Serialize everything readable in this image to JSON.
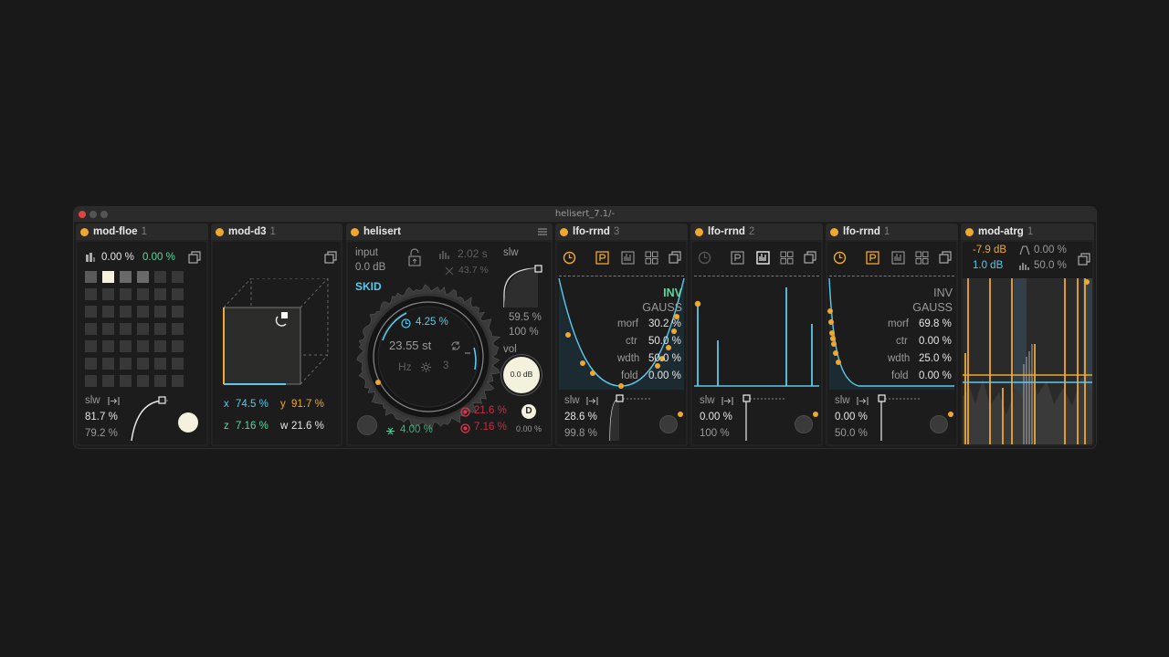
{
  "window": {
    "title": "helisert_7.1/-"
  },
  "colors": {
    "accent": "#f0a830",
    "cyan": "#5fc8ea",
    "green": "#5fd6a0",
    "red": "#e8304a"
  },
  "devices": {
    "floe": {
      "name": "mod-floe",
      "num": "1",
      "val1": "0.00 %",
      "val2": "0.00 %",
      "slw_label": "slw",
      "slw_val1": "81.7 %",
      "slw_val2": "79.2 %"
    },
    "d3": {
      "name": "mod-d3",
      "num": "1",
      "x_label": "x",
      "x_val": "74.5 %",
      "y_label": "y",
      "y_val": "91.7 %",
      "z_label": "z",
      "z_val": "7.16 %",
      "w_label": "w",
      "w_val": "21.6 %"
    },
    "heli": {
      "name": "helisert",
      "input_label": "input",
      "input_val": "0.0 dB",
      "time_val": "2.02 s",
      "amt_val": "43.7 %",
      "skid_label": "SKID",
      "ring_pct": "4.25 %",
      "ring_st": "23.55 st",
      "hz_label": "Hz",
      "ring_num": "3",
      "bottom_val": "4.00 %",
      "slw_label": "slw",
      "slw_val1": "59.5 %",
      "slw_val2": "100 %",
      "vol_label": "vol",
      "vol_val": "0.0 dB",
      "red_val1": "21.6 %",
      "red_val2": "7.16 %",
      "d_label": "D",
      "d_val": "0.00 %"
    },
    "lfo1": {
      "name": "lfo-rrnd",
      "num": "3",
      "inv": "INV",
      "gauss": "GAUSS",
      "morf_label": "morf",
      "morf_val": "30.2 %",
      "ctr_label": "ctr",
      "ctr_val": "50.0 %",
      "wdth_label": "wdth",
      "wdth_val": "50.0 %",
      "fold_label": "fold",
      "fold_val": "0.00 %",
      "slw_label": "slw",
      "slw_val1": "28.6 %",
      "slw_val2": "99.8 %"
    },
    "lfo2": {
      "name": "lfo-rrnd",
      "num": "2",
      "slw_label": "slw",
      "slw_val1": "0.00 %",
      "slw_val2": "100 %"
    },
    "lfo3": {
      "name": "lfo-rrnd",
      "num": "1",
      "inv": "INV",
      "gauss": "GAUSS",
      "morf_label": "morf",
      "morf_val": "69.8 %",
      "ctr_label": "ctr",
      "ctr_val": "0.00 %",
      "wdth_label": "wdth",
      "wdth_val": "25.0 %",
      "fold_label": "fold",
      "fold_val": "0.00 %",
      "slw_label": "slw",
      "slw_val1": "0.00 %",
      "slw_val2": "50.0 %"
    },
    "atrg": {
      "name": "mod-atrg",
      "num": "1",
      "db1": "-7.9 dB",
      "db2": "1.0 dB",
      "pct1": "0.00 %",
      "pct2": "50.0 %"
    }
  }
}
